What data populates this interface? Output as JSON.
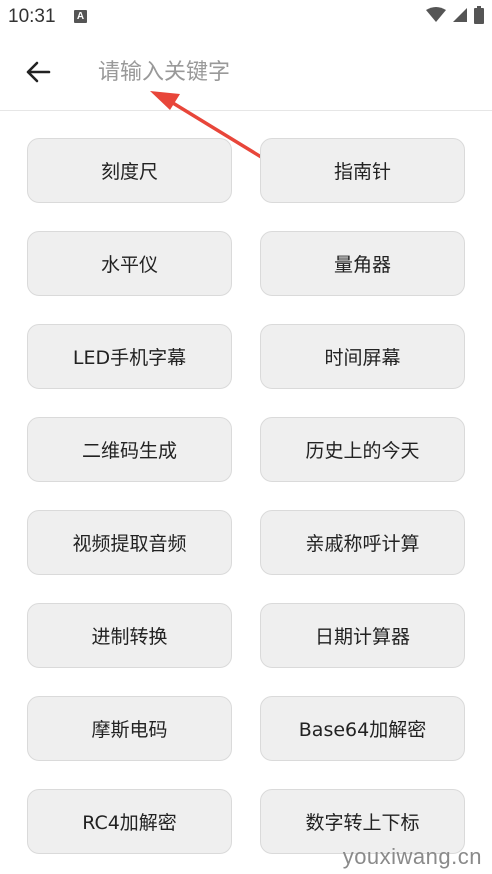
{
  "status_bar": {
    "time": "10:31",
    "notification_icon_letter": "A",
    "icons": [
      "wifi-icon",
      "signal-icon",
      "battery-icon"
    ]
  },
  "search": {
    "placeholder": "请输入关键字",
    "value": ""
  },
  "tools": [
    {
      "label": "刻度尺"
    },
    {
      "label": "指南针"
    },
    {
      "label": "水平仪"
    },
    {
      "label": "量角器"
    },
    {
      "label": "LED手机字幕"
    },
    {
      "label": "时间屏幕"
    },
    {
      "label": "二维码生成"
    },
    {
      "label": "历史上的今天"
    },
    {
      "label": "视频提取音频"
    },
    {
      "label": "亲戚称呼计算"
    },
    {
      "label": "进制转换"
    },
    {
      "label": "日期计算器"
    },
    {
      "label": "摩斯电码"
    },
    {
      "label": "Base64加解密"
    },
    {
      "label": "RC4加解密"
    },
    {
      "label": "数字转上下标"
    }
  ],
  "watermark": "youxiwang.cn",
  "colors": {
    "annotation_arrow": "#e8463a",
    "button_bg": "#efefef",
    "button_border": "#dadada",
    "placeholder": "#999999"
  }
}
